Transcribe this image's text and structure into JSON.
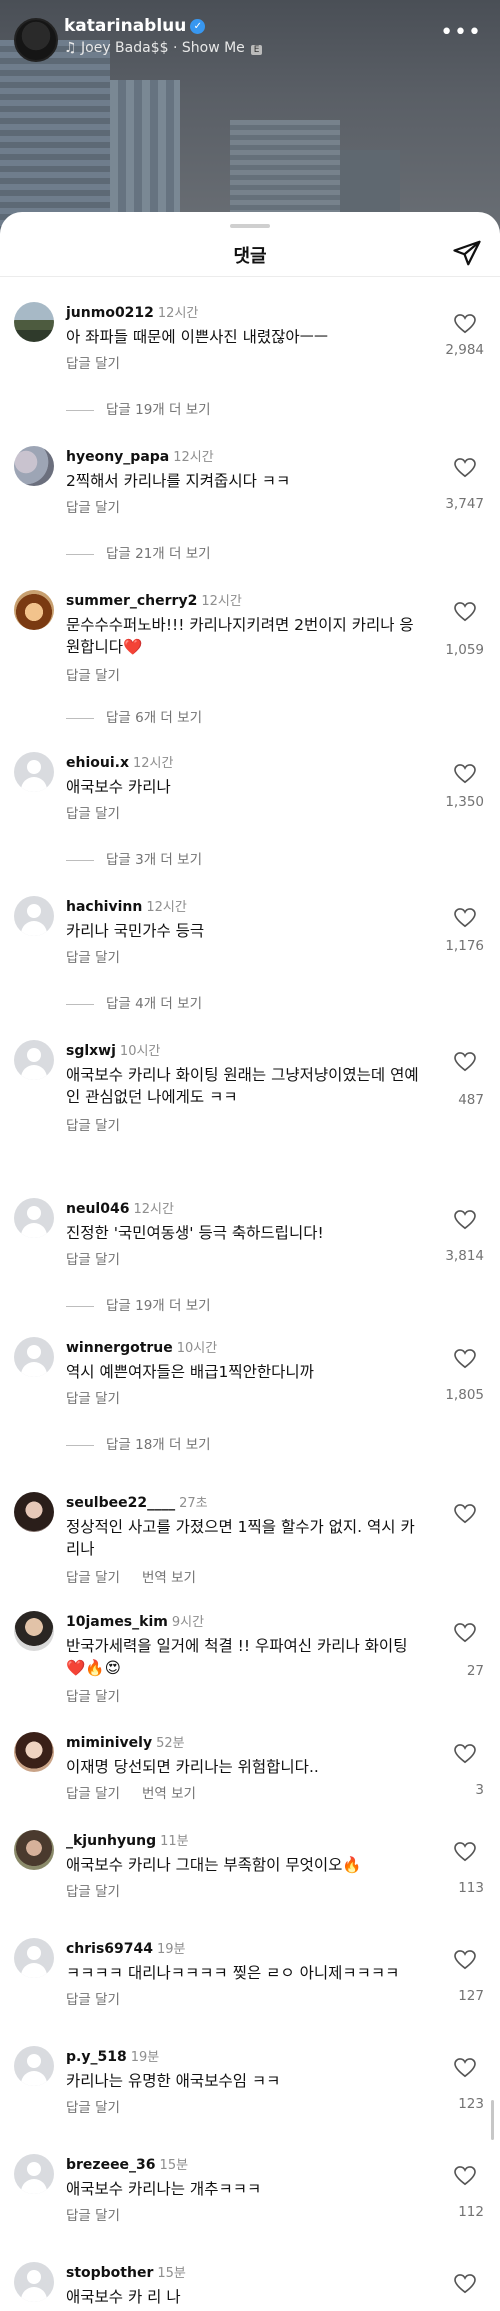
{
  "reel": {
    "username": "katarinabluu",
    "song": "Joey Bada$$ · Show Me",
    "song_badge": "E"
  },
  "sheet": {
    "title": "댓글"
  },
  "labels": {
    "reply": "답글 달기",
    "translate": "번역 보기"
  },
  "comments": [
    {
      "user": "junmo0212",
      "time": "12시간",
      "text": "아 좌파들 때문에 이쁜사진 내렸잖아ㅡㅡ",
      "likes": "2,984",
      "more": "답글 19개 더 보기"
    },
    {
      "user": "hyeony_papa",
      "time": "12시간",
      "text": "2찍해서 카리나를 지켜줍시다 ㅋㅋ",
      "likes": "3,747",
      "more": "답글 21개 더 보기"
    },
    {
      "user": "summer_cherry2",
      "time": "12시간",
      "text": "문수수수퍼노바!!! 카리나지키려면 2번이지 카리나 응원합니다❤️",
      "likes": "1,059",
      "more": "답글 6개 더 보기"
    },
    {
      "user": "ehioui.x",
      "time": "12시간",
      "text": "애국보수 카리나",
      "likes": "1,350",
      "more": "답글 3개 더 보기"
    },
    {
      "user": "hachivinn",
      "time": "12시간",
      "text": "카리나 국민가수 등극",
      "likes": "1,176",
      "more": "답글 4개 더 보기"
    },
    {
      "user": "sglxwj",
      "time": "10시간",
      "text": "애국보수 카리나 화이팅 원래는 그냥저냥이였는데 연예인 관심없던 나에게도 ㅋㅋ",
      "likes": "487"
    },
    {
      "user": "neul046",
      "time": "12시간",
      "text": "진정한 '국민여동생' 등극 축하드립니다!",
      "likes": "3,814",
      "more": "답글 19개 더 보기"
    },
    {
      "user": "winnergotrue",
      "time": "10시간",
      "text": "역시 예쁜여자들은 배급1찍안한다니까",
      "likes": "1,805",
      "more": "답글 18개 더 보기"
    },
    {
      "user": "seulbee22____",
      "time": "27초",
      "text": "정상적인 사고를 가졌으면 1찍을 할수가 없지. 역시 카리나",
      "likes": ""
    },
    {
      "user": "10james_kim",
      "time": "9시간",
      "text": "반국가세력을 일거에 척결 !! 우파여신 카리나 화이팅 ❤️🔥😍",
      "likes": "27"
    },
    {
      "user": "miminively",
      "time": "52분",
      "text": "이재명 당선되면 카리나는 위험합니다..",
      "likes": "3"
    },
    {
      "user": "_kjunhyung",
      "time": "11분",
      "text": "애국보수 카리나 그대는 부족함이 무엇이오🔥",
      "likes": "113"
    },
    {
      "user": "chris69744",
      "time": "19분",
      "text": "ㅋㅋㅋㅋ 대리나ㅋㅋㅋㅋ 찢은 ㄹㅇ 아니제ㅋㅋㅋㅋ",
      "likes": "127"
    },
    {
      "user": "p.y_518",
      "time": "19분",
      "text": "카리나는 유명한 애국보수임 ㅋㅋ",
      "likes": "123"
    },
    {
      "user": "brezeee_36",
      "time": "15분",
      "text": "애국보수 카리나는 개추ㅋㅋㅋ",
      "likes": "112"
    },
    {
      "user": "stopbother",
      "time": "15분",
      "text": "애국보수 카 리 나",
      "likes": ""
    }
  ]
}
